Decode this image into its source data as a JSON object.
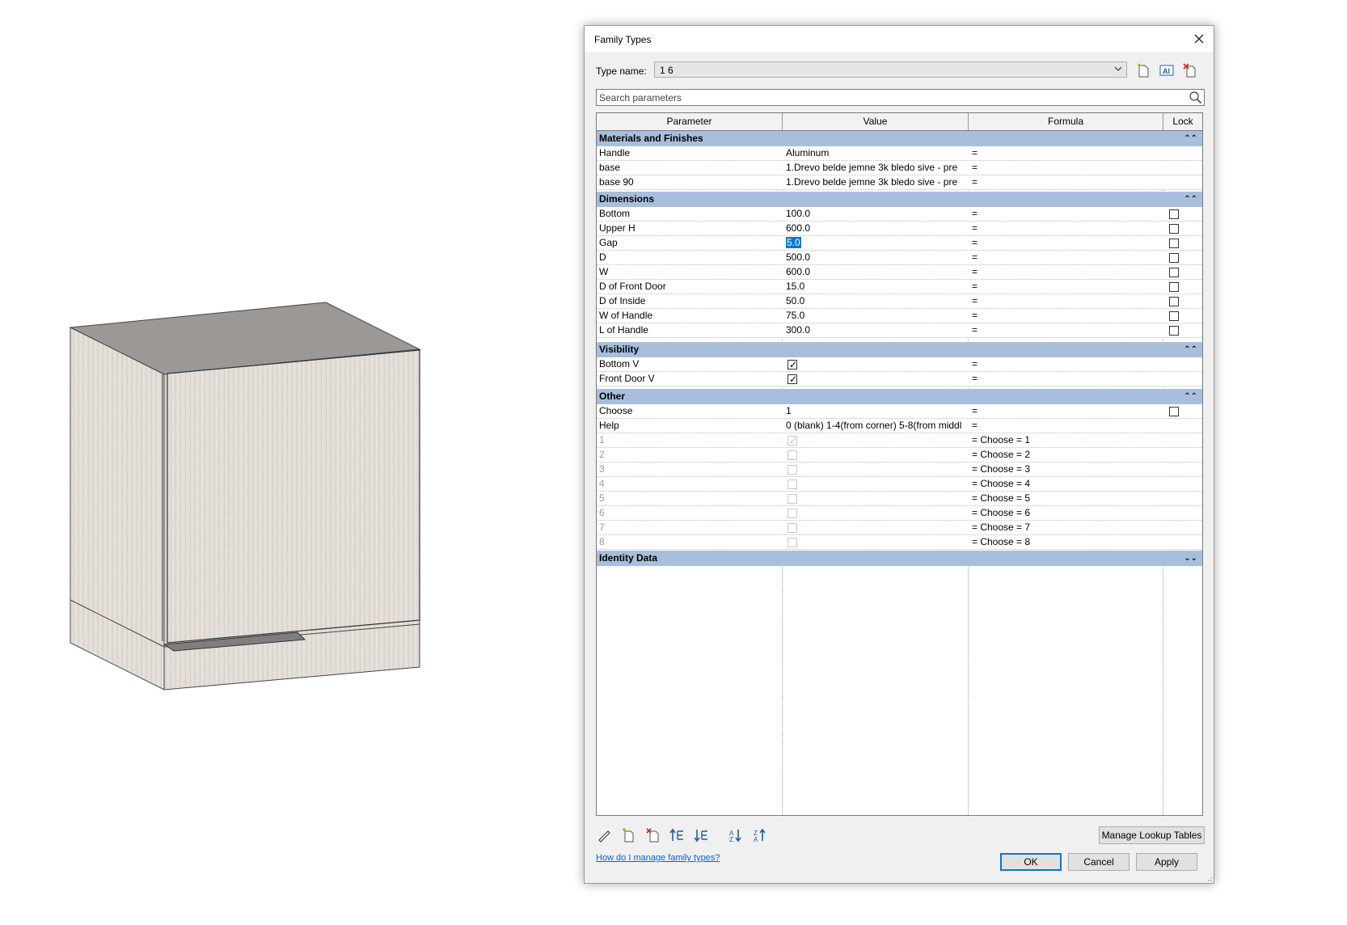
{
  "dialog": {
    "title": "Family Types",
    "type_name_label": "Type name:",
    "type_name_value": "1 6",
    "search_placeholder": "Search parameters",
    "columns": [
      "Parameter",
      "Value",
      "Formula",
      "Lock"
    ],
    "groups": {
      "materials": {
        "label": "Materials and Finishes",
        "collapse_icon": "chevron-double-up-icon"
      },
      "dimensions": {
        "label": "Dimensions",
        "collapse_icon": "chevron-double-up-icon"
      },
      "visibility": {
        "label": "Visibility",
        "collapse_icon": "chevron-double-up-icon"
      },
      "other": {
        "label": "Other",
        "collapse_icon": "chevron-double-up-icon"
      },
      "identity": {
        "label": "Identity Data",
        "collapse_icon": "chevron-double-down-icon"
      }
    },
    "materials_rows": [
      {
        "param": "Handle",
        "value": "Aluminum",
        "formula": "="
      },
      {
        "param": "base",
        "value": "1.Drevo belde jemne 3k bledo sive - pre",
        "formula": "="
      },
      {
        "param": "base 90",
        "value": "1.Drevo belde jemne 3k bledo sive - pre",
        "formula": "="
      }
    ],
    "dimension_rows": [
      {
        "param": "Bottom",
        "value": "100.0",
        "formula": "=",
        "locked": false
      },
      {
        "param": "Upper H",
        "value": "600.0",
        "formula": "=",
        "locked": false
      },
      {
        "param": "Gap",
        "value": "5.0",
        "formula": "=",
        "locked": false,
        "selected": true
      },
      {
        "param": "D",
        "value": "500.0",
        "formula": "=",
        "locked": false
      },
      {
        "param": "W",
        "value": "600.0",
        "formula": "=",
        "locked": false
      },
      {
        "param": "D of Front Door",
        "value": "15.0",
        "formula": "=",
        "locked": false
      },
      {
        "param": "D of Inside",
        "value": "50.0",
        "formula": "=",
        "locked": false
      },
      {
        "param": "W of Handle",
        "value": "75.0",
        "formula": "=",
        "locked": false
      },
      {
        "param": "L of Handle",
        "value": "300.0",
        "formula": "=",
        "locked": false
      }
    ],
    "visibility_rows": [
      {
        "param": "Bottom V",
        "checked": true,
        "formula": "="
      },
      {
        "param": "Front Door V",
        "checked": true,
        "formula": "="
      }
    ],
    "other_rows": [
      {
        "param": "Choose",
        "value": "1",
        "formula": "=",
        "lock": true,
        "checkbox": false
      },
      {
        "param": "Help",
        "value": "0 (blank) 1-4(from corner) 5-8(from middl",
        "formula": "=",
        "lock": false,
        "checkbox": false
      },
      {
        "param": "1",
        "checked": true,
        "formula": "= Choose = 1",
        "checkbox": true
      },
      {
        "param": "2",
        "checked": false,
        "formula": "= Choose = 2",
        "checkbox": true
      },
      {
        "param": "3",
        "checked": false,
        "formula": "= Choose = 3",
        "checkbox": true
      },
      {
        "param": "4",
        "checked": false,
        "formula": "= Choose = 4",
        "checkbox": true
      },
      {
        "param": "5",
        "checked": false,
        "formula": "= Choose = 5",
        "checkbox": true
      },
      {
        "param": "6",
        "checked": false,
        "formula": "= Choose = 6",
        "checkbox": true
      },
      {
        "param": "7",
        "checked": false,
        "formula": "= Choose = 7",
        "checkbox": true
      },
      {
        "param": "8",
        "checked": false,
        "formula": "= Choose = 8",
        "checkbox": true
      }
    ],
    "toolbar_icons": [
      "new-type-icon",
      "rename-type-icon",
      "delete-type-icon"
    ],
    "bottom_icons": [
      "edit-parameter-icon",
      "new-parameter-icon",
      "delete-parameter-icon",
      "move-up-icon",
      "move-down-icon",
      "sort-ascending-icon",
      "sort-descending-icon"
    ],
    "manage_lookup_label": "Manage Lookup Tables",
    "help_link": "How do I manage family types?",
    "ok_label": "OK",
    "cancel_label": "Cancel",
    "apply_label": "Apply",
    "colors": {
      "group_header": "#a7bfdc",
      "selection": "#0078d7",
      "link": "#0066cc"
    }
  },
  "viewport": {
    "model": "base-cabinet-3d-view"
  }
}
